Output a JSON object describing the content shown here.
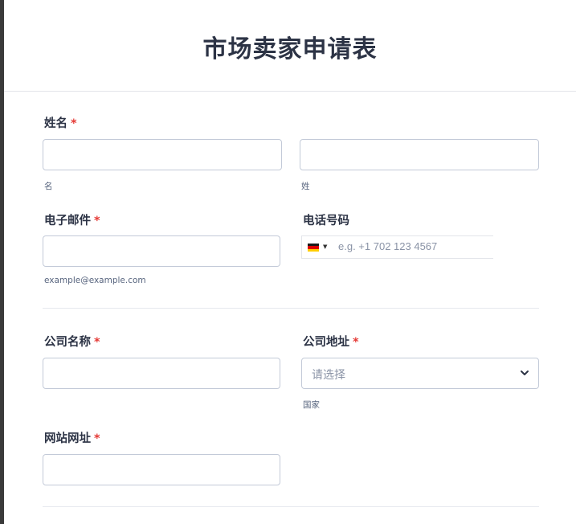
{
  "form": {
    "title": "市场卖家申请表",
    "required_mark": "*",
    "name": {
      "label": "姓名",
      "first_sublabel": "名",
      "last_sublabel": "姓",
      "first_value": "",
      "last_value": ""
    },
    "email": {
      "label": "电子邮件",
      "sublabel": "example@example.com",
      "value": ""
    },
    "phone": {
      "label": "电话号码",
      "placeholder": "e.g. +1 702 123 4567",
      "country_flag": "germany-flag-icon",
      "value": ""
    },
    "company_name": {
      "label": "公司名称",
      "value": ""
    },
    "company_address": {
      "label": "公司地址",
      "placeholder": "请选择",
      "sublabel": "国家",
      "value": ""
    },
    "website": {
      "label": "网站网址",
      "value": ""
    }
  },
  "colors": {
    "required": "#e53935",
    "text": "#2c3345",
    "border": "#c3cad8"
  }
}
